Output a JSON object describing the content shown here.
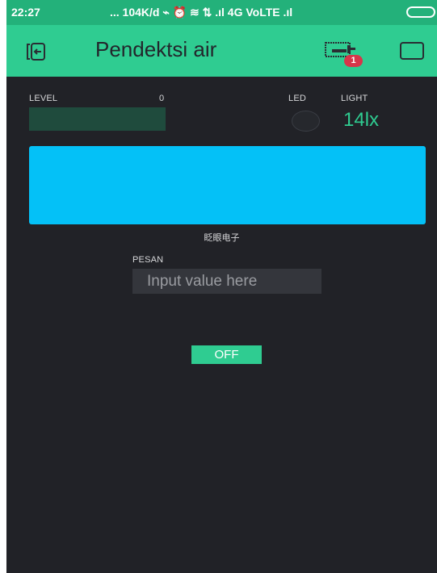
{
  "status_bar": {
    "time": "22:27",
    "indicators": "... 104K/d ⌁ ⏰ ≋ ⇅ .ıl 4G VoLTE .ıl"
  },
  "app_bar": {
    "title": "Pendektsi air",
    "notification_count": "1"
  },
  "level": {
    "label": "LEVEL",
    "value": "0",
    "fill_percent": 0
  },
  "led": {
    "label": "LED"
  },
  "light": {
    "label": "LIGHT",
    "value": "14lx"
  },
  "blue_panel": {
    "color": "#04c1f7",
    "caption": "眨眼电子"
  },
  "pesan": {
    "label": "PESAN",
    "placeholder": "Input value here"
  },
  "switch": {
    "label": "OFF"
  },
  "colors": {
    "accent": "#2fcc91",
    "background": "#212227",
    "badge": "#d8354a"
  }
}
